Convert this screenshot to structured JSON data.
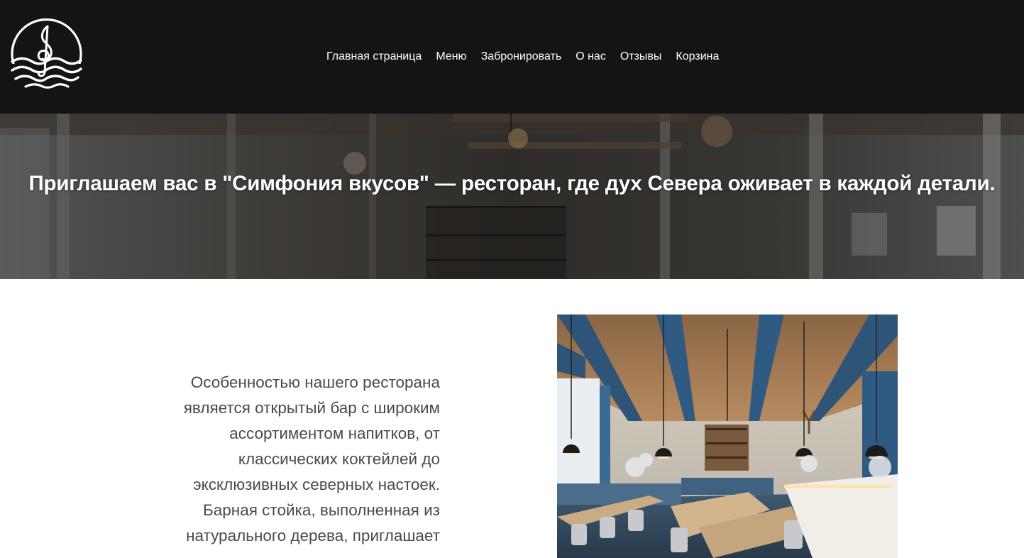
{
  "header": {
    "logo_icon": "treble-clef-waves-icon",
    "nav": [
      {
        "label": "Главная страница"
      },
      {
        "label": "Меню"
      },
      {
        "label": "Забронировать"
      },
      {
        "label": "О нас"
      },
      {
        "label": "Отзывы"
      },
      {
        "label": "Корзина"
      }
    ]
  },
  "hero": {
    "title": "Приглашаем вас в \"Симфония вкусов\" — ресторан, где дух Севера оживает в каждой детали."
  },
  "feature": {
    "text": "Особенностью нашего ресторана является открытый бар с широким ассортиментом напитков, от классических коктейлей до эксклюзивных северных настоек. Барная стойка, выполненная из натурального дерева, приглашает"
  },
  "colors": {
    "header_bg": "#141414",
    "nav_text": "#ffffff",
    "body_text": "#4a4a4a"
  }
}
